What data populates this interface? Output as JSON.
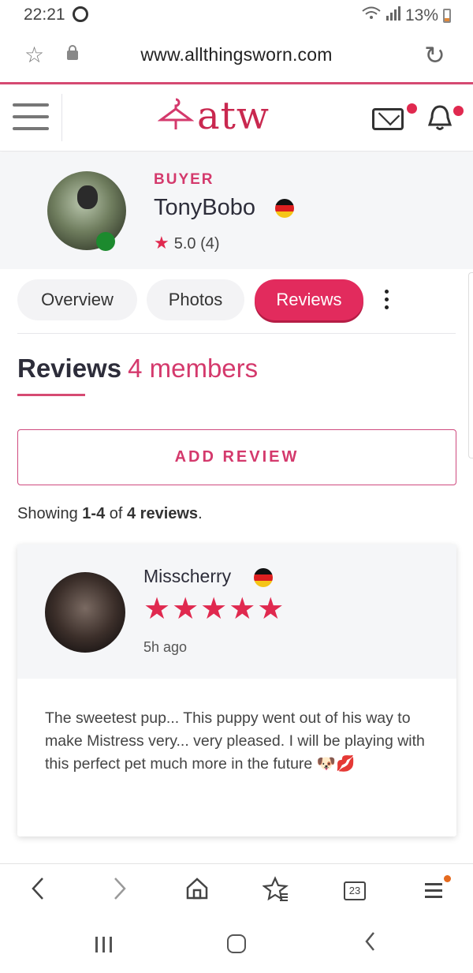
{
  "status_bar": {
    "time": "22:21",
    "battery": "13%",
    "icons": [
      "wifi-icon",
      "signal-icon",
      "battery-icon"
    ]
  },
  "browser": {
    "url": "www.allthingsworn.com",
    "tab_count": "23"
  },
  "site": {
    "logo_text": "atw",
    "accent_color": "#d4396c"
  },
  "profile": {
    "role": "BUYER",
    "username": "TonyBobo",
    "rating": "5.0 (4)"
  },
  "tabs": [
    {
      "label": "Overview",
      "active": false
    },
    {
      "label": "Photos",
      "active": false
    },
    {
      "label": "Reviews",
      "active": true
    }
  ],
  "reviews_section": {
    "title": "Reviews",
    "count_label": "4 members",
    "add_review_label": "ADD REVIEW",
    "showing_prefix": "Showing ",
    "showing_range": "1-4",
    "showing_mid": " of ",
    "showing_total": "4 reviews",
    "showing_suffix": "."
  },
  "reviews": [
    {
      "name": "Misscherry",
      "stars": 5,
      "stars_text": "★★★★★",
      "time_ago": "5h ago",
      "text": "The sweetest pup... This puppy went out of his way to make Mistress very... very pleased. I will be playing with this perfect pet much more in the future 🐶💋"
    }
  ]
}
